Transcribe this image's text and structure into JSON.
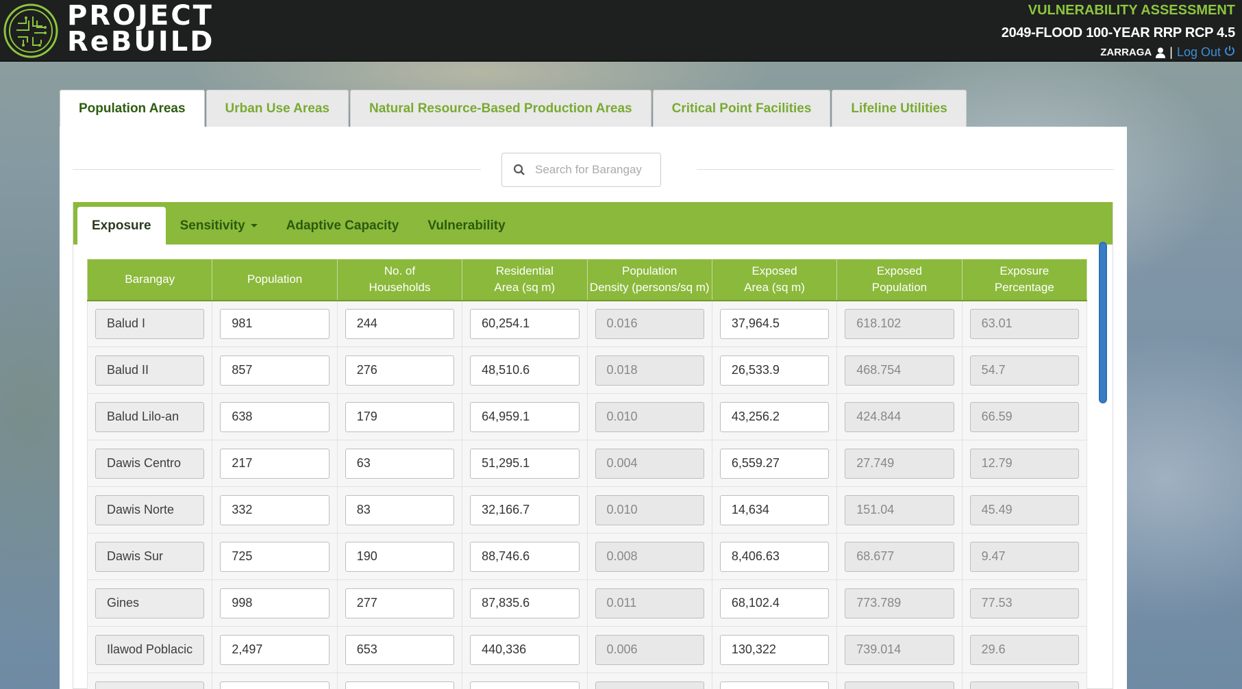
{
  "header": {
    "logo_line1": "PROJECT",
    "logo_line2": "ReBUILD",
    "title": "VULNERABILITY ASSESSMENT",
    "scenario": "2049-FLOOD 100-YEAR RRP RCP 4.5",
    "user": "ZARRAGA",
    "separator": "|",
    "logout": "Log Out",
    "accent_color": "#8cc63f"
  },
  "top_tabs": [
    {
      "label": "Population Areas",
      "active": true
    },
    {
      "label": "Urban Use Areas",
      "active": false
    },
    {
      "label": "Natural Resource-Based Production Areas",
      "active": false
    },
    {
      "label": "Critical Point Facilities",
      "active": false
    },
    {
      "label": "Lifeline Utilities",
      "active": false
    }
  ],
  "search": {
    "placeholder": "Search for Barangay",
    "value": ""
  },
  "sub_tabs": [
    {
      "label": "Exposure",
      "active": true,
      "dropdown": false
    },
    {
      "label": "Sensitivity",
      "active": false,
      "dropdown": true
    },
    {
      "label": "Adaptive Capacity",
      "active": false,
      "dropdown": false
    },
    {
      "label": "Vulnerability",
      "active": false,
      "dropdown": false
    }
  ],
  "table": {
    "columns": [
      [
        "Barangay"
      ],
      [
        "Population"
      ],
      [
        "No. of",
        "Households"
      ],
      [
        "Residential",
        "Area (sq m)"
      ],
      [
        "Population",
        "Density (persons/sq m)"
      ],
      [
        "Exposed",
        "Area (sq m)"
      ],
      [
        "Exposed",
        "Population"
      ],
      [
        "Exposure",
        "Percentage"
      ]
    ],
    "rows": [
      [
        "Balud I",
        "981",
        "244",
        "60,254.1",
        "0.016",
        "37,964.5",
        "618.102",
        "63.01"
      ],
      [
        "Balud II",
        "857",
        "276",
        "48,510.6",
        "0.018",
        "26,533.9",
        "468.754",
        "54.7"
      ],
      [
        "Balud Lilo-an",
        "638",
        "179",
        "64,959.1",
        "0.010",
        "43,256.2",
        "424.844",
        "66.59"
      ],
      [
        "Dawis Centro",
        "217",
        "63",
        "51,295.1",
        "0.004",
        "6,559.27",
        "27.749",
        "12.79"
      ],
      [
        "Dawis Norte",
        "332",
        "83",
        "32,166.7",
        "0.010",
        "14,634",
        "151.04",
        "45.49"
      ],
      [
        "Dawis Sur",
        "725",
        "190",
        "88,746.6",
        "0.008",
        "8,406.63",
        "68.677",
        "9.47"
      ],
      [
        "Gines",
        "998",
        "277",
        "87,835.6",
        "0.011",
        "68,102.4",
        "773.789",
        "77.53"
      ],
      [
        "Ilawod Poblacic",
        "2,497",
        "653",
        "440,336",
        "0.006",
        "130,322",
        "739.014",
        "29.6"
      ],
      [
        "",
        "",
        "",
        "",
        "",
        "",
        "",
        ""
      ]
    ],
    "column_kinds": [
      "name",
      "input",
      "input",
      "input",
      "readonly",
      "input",
      "readonly",
      "readonly"
    ]
  }
}
